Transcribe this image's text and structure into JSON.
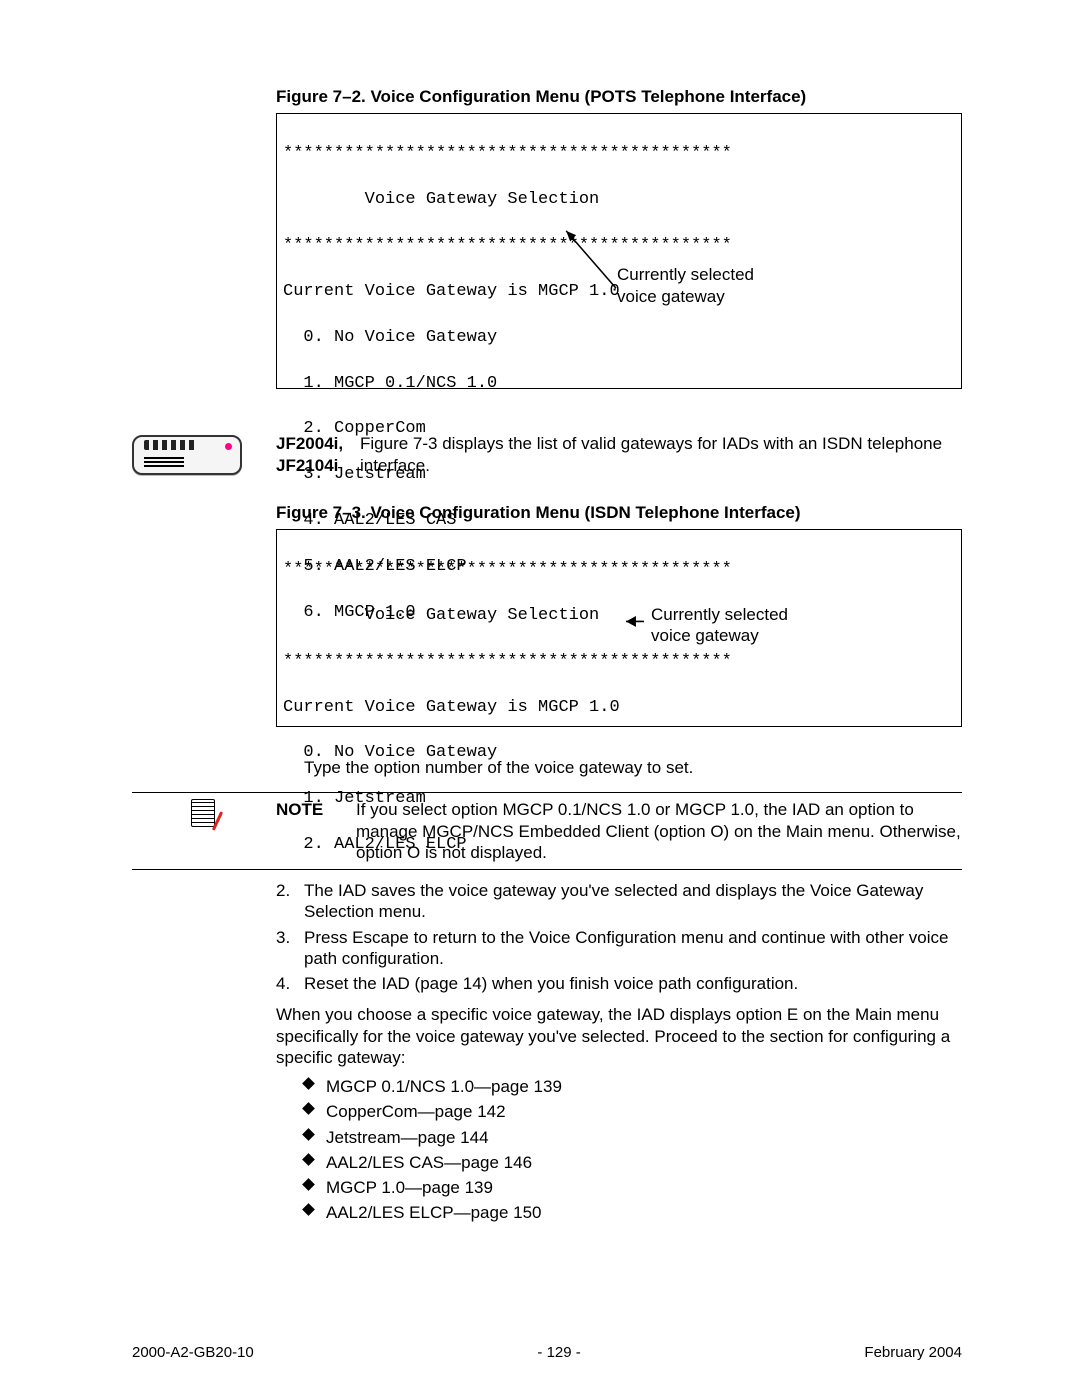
{
  "figure1": {
    "caption": "Figure 7–2.  Voice Configuration Menu (POTS Telephone Interface)",
    "divider": "********************************************",
    "title": "        Voice Gateway Selection",
    "currentLine": "Current Voice Gateway is MGCP 1.0",
    "options": [
      "  0. No Voice Gateway",
      "  1. MGCP 0.1/NCS 1.0",
      "  2. CopperCom",
      "  3. Jetstream",
      "  4. AAL2/LES CAS",
      "  5. AAL2/LES ELCP",
      "  6. MGCP 1.0"
    ],
    "calloutLabel": "Currently selected\nvoice gateway"
  },
  "jfBlock": {
    "models1": "JF2004i,",
    "models2": "JF2104i",
    "text": "Figure 7-3 displays the list of valid gateways for IADs with an ISDN telephone interface."
  },
  "figure2": {
    "caption": "Figure 7–3.  Voice Configuration Menu (ISDN Telephone Interface)",
    "divider": "********************************************",
    "title": "        Voice Gateway Selection",
    "currentLine": "Current Voice Gateway is MGCP 1.0",
    "options": [
      "  0. No Voice Gateway",
      "  1. Jetstream",
      "  2. AAL2/LES ELCP"
    ],
    "calloutLabel": "Currently selected\nvoice gateway"
  },
  "instructionPara": "Type the option number of the voice gateway to set.",
  "noteBlock": {
    "label": "NOTE",
    "text": "If you select option MGCP 0.1/NCS 1.0 or MGCP 1.0, the IAD an option to manage MGCP/NCS Embedded Client (option O) on the Main menu. Otherwise, option O is not displayed."
  },
  "steps": {
    "s2": "The IAD saves the voice gateway you've selected and displays the Voice Gateway Selection menu.",
    "s3": "Press Escape to return to the Voice Configuration menu and continue with other voice path configuration.",
    "s4": "Reset the IAD (page 14) when you finish voice path configuration."
  },
  "afterSteps": "When you choose a specific voice gateway, the IAD displays option E on the Main menu specifically for the voice gateway you've selected. Proceed to the section for configuring a specific gateway:",
  "bullets": [
    "MGCP 0.1/NCS 1.0—page 139",
    "CopperCom—page 142",
    "Jetstream—page 144",
    "AAL2/LES CAS—page 146",
    "MGCP 1.0—page 139",
    "AAL2/LES ELCP—page 150"
  ],
  "footer": {
    "left": "2000-A2-GB20-10",
    "center": "- 129 -",
    "right": "February 2004"
  }
}
